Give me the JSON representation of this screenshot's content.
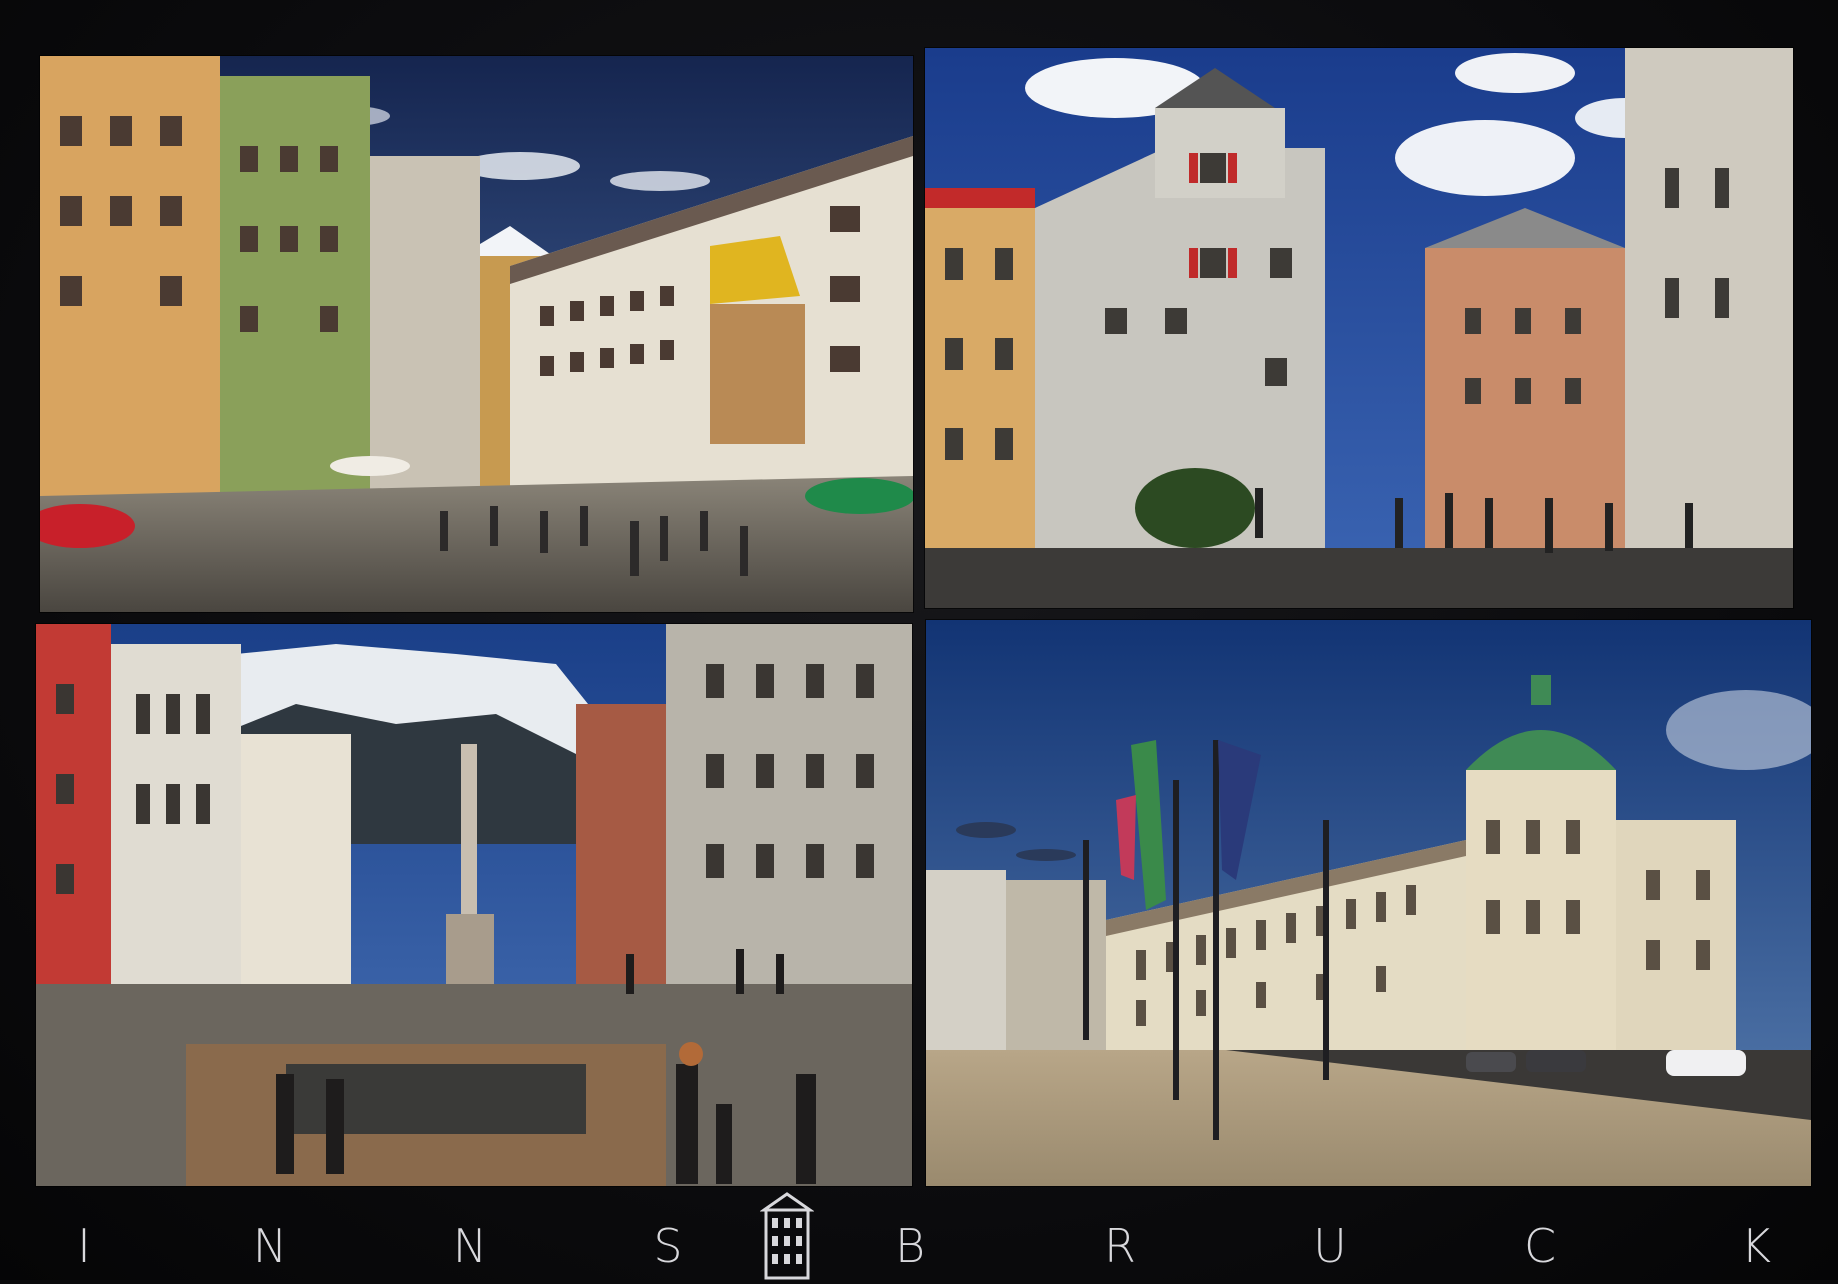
{
  "postcard": {
    "city_letters": [
      "I",
      "N",
      "N",
      "S",
      "B",
      "R",
      "U",
      "C",
      "K"
    ]
  },
  "photos": [
    {
      "name": "photo-golden-roof"
    },
    {
      "name": "photo-helbling-house"
    },
    {
      "name": "photo-maria-theresien-strasse"
    },
    {
      "name": "photo-hofburg-palace"
    }
  ],
  "colors": {
    "sky_blue": "#1f3d7a",
    "golden_roof": "#e0b520",
    "dome_green": "#3f8a55",
    "text_light": "#d8d8dc"
  }
}
